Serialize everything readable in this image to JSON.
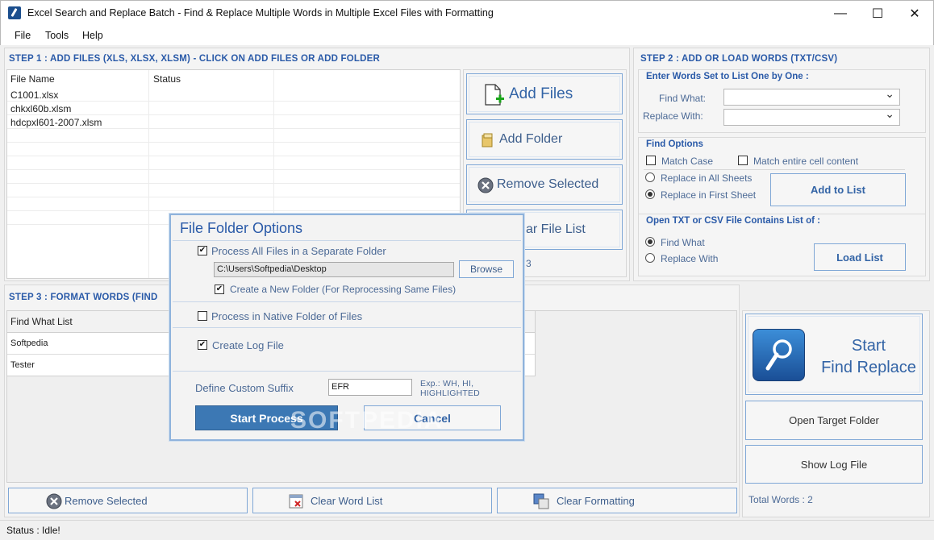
{
  "window": {
    "title": "Excel Search and Replace Batch - Find & Replace Multiple Words in Multiple Excel Files with Formatting",
    "minimize": "—",
    "maximize": "☐",
    "close": "✕"
  },
  "menu": [
    "File",
    "Tools",
    "Help"
  ],
  "step1": {
    "heading": "STEP 1 : ADD FILES (XLS, XLSX, XLSM) - CLICK ON ADD FILES OR ADD FOLDER",
    "columns": [
      "File Name",
      "Status"
    ],
    "files": [
      {
        "name": "C1001.xlsx",
        "status": ""
      },
      {
        "name": "chkxl60b.xlsm",
        "status": ""
      },
      {
        "name": "hdcpxl601-2007.xlsm",
        "status": ""
      }
    ],
    "add_files": "Add Files",
    "add_folder": "Add Folder",
    "remove_selected": "Remove Selected",
    "clear_file_list_partial": "ar File List",
    "count_partial": "3"
  },
  "step2": {
    "heading": "STEP 2 : ADD OR LOAD WORDS (TXT/CSV)",
    "enter_words_title": "Enter Words Set to List One by One :",
    "find_what_label": "Find What:",
    "replace_with_label": "Replace With:",
    "find_what_value": "",
    "replace_with_value": "",
    "find_options_title": "Find Options",
    "match_case": "Match Case",
    "match_entire": "Match entire cell content",
    "replace_all_sheets": "Replace in All Sheets",
    "replace_first_sheet": "Replace in First Sheet",
    "add_to_list": "Add to List",
    "open_file_title": "Open TXT or CSV File Contains List of :",
    "radio_find_what": "Find What",
    "radio_replace_with": "Replace With",
    "load_list": "Load List"
  },
  "step3": {
    "heading_partial": "STEP 3 : FORMAT WORDS (FIND",
    "column": "Find What List",
    "words": [
      "Softpedia",
      "Tester"
    ],
    "remove_selected": "Remove Selected",
    "clear_word_list": "Clear Word List",
    "clear_formatting": "Clear Formatting"
  },
  "right": {
    "start_line1": "Start",
    "start_line2": "Find Replace",
    "open_target_folder": "Open Target Folder",
    "show_log_file": "Show Log File",
    "total_words": "Total Words : 2"
  },
  "dialog": {
    "title": "File Folder Options",
    "process_separate": "Process All Files in a Separate Folder",
    "path": "C:\\Users\\Softpedia\\Desktop",
    "browse": "Browse",
    "create_new_folder": "Create a New Folder (For Reprocessing Same Files)",
    "process_native": "Process in Native Folder of Files",
    "create_log": "Create Log File",
    "suffix_label": "Define Custom Suffix",
    "suffix_value": "EFR",
    "suffix_hint": "Exp.: WH, HI, HIGHLIGHTED",
    "start_process": "Start Process",
    "cancel": "Cancel",
    "checks": {
      "process_separate": true,
      "create_new_folder": true,
      "process_native": false,
      "create_log": true
    }
  },
  "status": {
    "text": "Status  :  Idle!"
  },
  "watermark": "SOFTPEDIA"
}
